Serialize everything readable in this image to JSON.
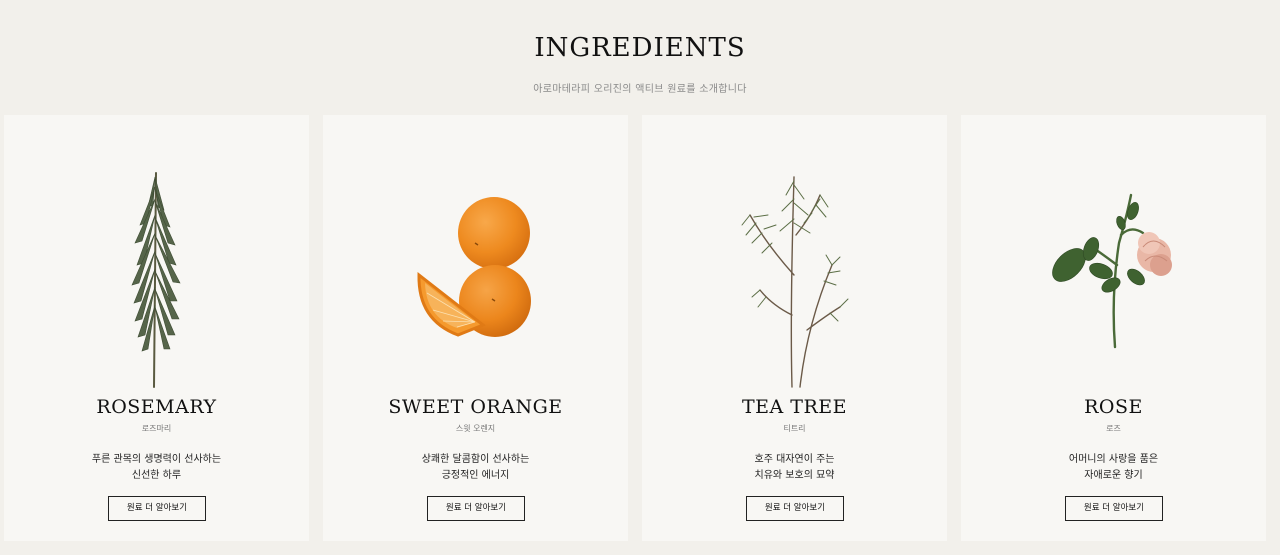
{
  "section": {
    "title": "INGREDIENTS",
    "subtitle": "아로마테라피 오리진의 액티브 원료를 소개합니다"
  },
  "cards": [
    {
      "name": "ROSEMARY",
      "korean_name": "로즈마리",
      "description_line1": "푸른 관목의 생명력이 선사하는",
      "description_line2": "신선한 하루",
      "button_label": "원료 더 알아보기"
    },
    {
      "name": "SWEET ORANGE",
      "korean_name": "스윗 오렌지",
      "description_line1": "상쾌한 달콤함이 선사하는",
      "description_line2": "긍정적인 에너지",
      "button_label": "원료 더 알아보기"
    },
    {
      "name": "TEA TREE",
      "korean_name": "티트리",
      "description_line1": "호주 대자연이 주는",
      "description_line2": "치유와 보호의 묘약",
      "button_label": "원료 더 알아보기"
    },
    {
      "name": "ROSE",
      "korean_name": "로즈",
      "description_line1": "어머니의 사랑을 품은",
      "description_line2": "자애로운 향기",
      "button_label": "원료 더 알아보기"
    }
  ],
  "colors": {
    "page_background": "#f2f0eb",
    "card_background": "#f8f7f4",
    "text": "#111111",
    "muted_text": "#8a8a8a"
  },
  "icons": [
    "rosemary-illustration",
    "orange-illustration",
    "tea-tree-illustration",
    "rose-illustration"
  ]
}
